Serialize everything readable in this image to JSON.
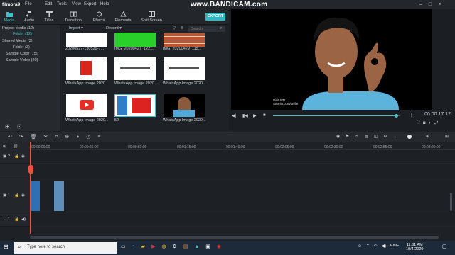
{
  "app": {
    "name": "filmora9",
    "menus": [
      "File",
      "Edit",
      "Tools",
      "View",
      "Export",
      "Help"
    ],
    "watermark": "www.BANDICAM.com"
  },
  "toolbar": {
    "items": [
      "Media",
      "Audio",
      "Titles",
      "Transition",
      "Effects",
      "Elements",
      "Split Screen"
    ],
    "export_label": "EXPORT"
  },
  "sidebar": {
    "items": [
      "Project Media (12)",
      "Folder (12)",
      "Shared Media (3)",
      "Folder (3)",
      "Sample Color (15)",
      "Sample Video (20)"
    ]
  },
  "library": {
    "import_label": "Import",
    "record_label": "Record",
    "search_placeholder": "Search",
    "items": [
      {
        "caption": "20200527-130529-7...",
        "kind": "white"
      },
      {
        "caption": "IMG_20200427_122...",
        "kind": "green"
      },
      {
        "caption": "IMG_20200429_115...",
        "kind": "brick"
      },
      {
        "caption": "WhatsApp Image 2020...",
        "kind": "logo-k"
      },
      {
        "caption": "WhatsApp Image 2020...",
        "kind": "white-text"
      },
      {
        "caption": "WhatsApp Image 2020...",
        "kind": "white-text"
      },
      {
        "caption": "WhatsApp Image 2020...",
        "kind": "youtube"
      },
      {
        "caption": "52",
        "kind": "poster"
      },
      {
        "caption": "WhatsApp Image 2020...",
        "kind": "portrait"
      }
    ]
  },
  "player": {
    "timecode": "00:00:17:12",
    "progress": 0.97,
    "video_watermark": "Visit IVN\nSMP.in.com/selfie"
  },
  "timeline": {
    "ticks": [
      "00:00:00:00",
      "00:00:25:00",
      "00:00:50:00",
      "00:01:15:00",
      "00:01:40:00",
      "00:02:05:00",
      "00:02:30:00",
      "00:02:55:00",
      "00:03:20:00"
    ],
    "tracks": [
      "2",
      "1",
      "1"
    ]
  },
  "taskbar": {
    "search_placeholder": "Type here to search",
    "time": "11:31 AM",
    "date": "10/4/2020",
    "lang": "ENG"
  },
  "colors": {
    "accent": "#3fc1c9",
    "playhead": "#e8543d"
  }
}
